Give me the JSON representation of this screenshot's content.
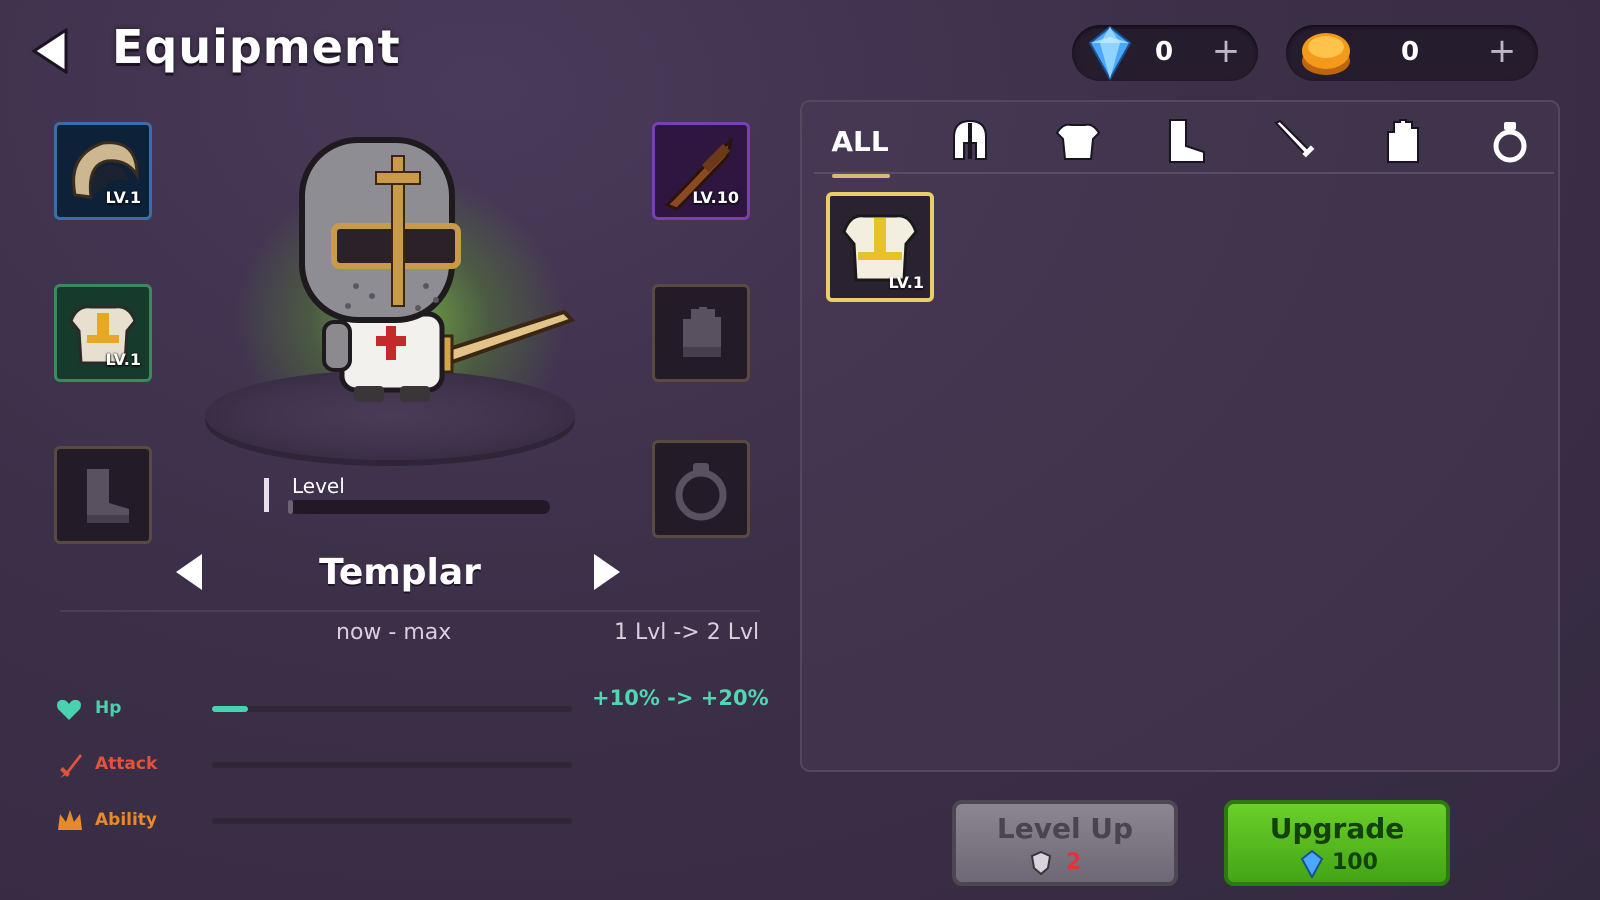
{
  "header": {
    "title": "Equipment"
  },
  "currencies": [
    {
      "icon": "gem-icon",
      "value": "0",
      "plus": "+"
    },
    {
      "icon": "coin-icon",
      "value": "0",
      "plus": "+"
    }
  ],
  "slots": {
    "helmet": {
      "level": "LV.1"
    },
    "armor": {
      "level": "LV.1"
    },
    "boots": {
      "level": ""
    },
    "weapon": {
      "level": "LV.10"
    },
    "gloves": {
      "level": ""
    },
    "ring": {
      "level": ""
    }
  },
  "hero": {
    "level_label": "Level",
    "level_progress": 0.02,
    "name": "Templar"
  },
  "stats": {
    "col_now_max": "now - max",
    "col_upgrade": "1 Lvl -> 2 Lvl",
    "rows": [
      {
        "label": "Hp",
        "color": "#48d2b0",
        "progress": 0.1
      },
      {
        "label": "Attack",
        "color": "#e0533c",
        "progress": 0
      },
      {
        "label": "Ability",
        "color": "#e88a2c",
        "progress": 0
      }
    ],
    "hp_bonus": "+10% -> +20%"
  },
  "inventory": {
    "tabs": [
      {
        "label": "ALL",
        "icon": ""
      },
      {
        "label": "",
        "icon": "helmet-icon"
      },
      {
        "label": "",
        "icon": "armor-icon"
      },
      {
        "label": "",
        "icon": "boot-icon"
      },
      {
        "label": "",
        "icon": "sword-icon"
      },
      {
        "label": "",
        "icon": "glove-icon"
      },
      {
        "label": "",
        "icon": "ring-icon"
      }
    ],
    "items": [
      {
        "icon": "armor-icon",
        "level": "LV.1"
      }
    ]
  },
  "buttons": {
    "level_up": {
      "label": "Level Up",
      "cost": "2"
    },
    "upgrade": {
      "label": "Upgrade",
      "cost": "100"
    }
  }
}
